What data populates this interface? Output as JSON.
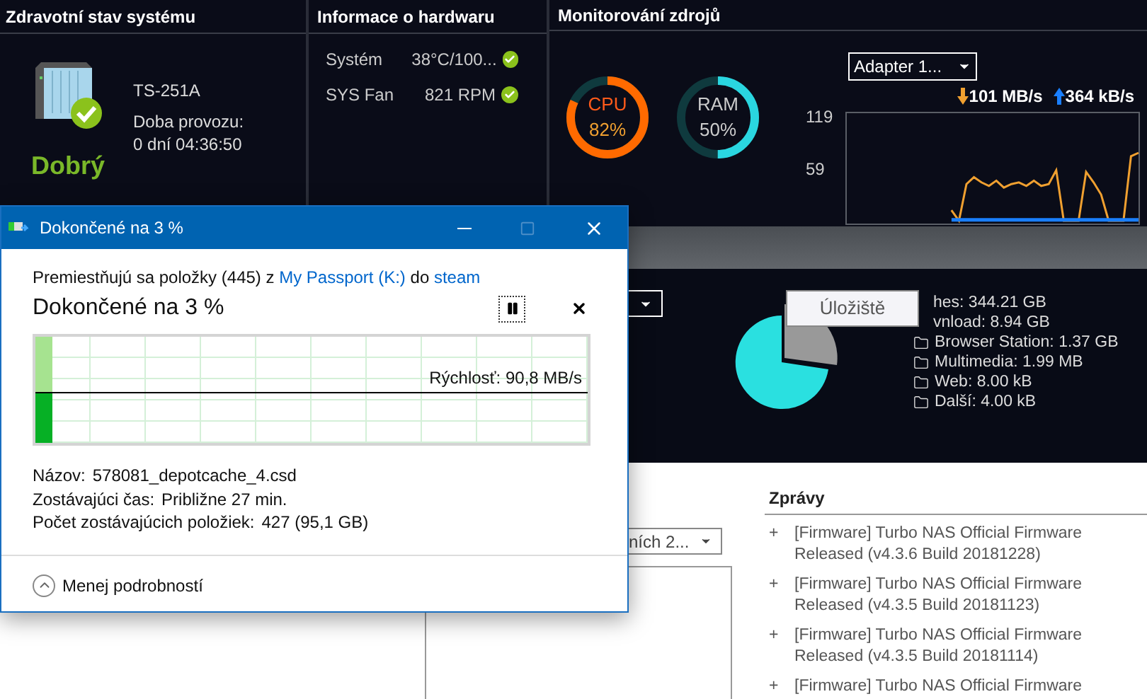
{
  "system_health": {
    "title": "Zdravotní stav systému",
    "model": "TS-251A",
    "uptime_label": "Doba provozu:",
    "uptime": "0 dní 04:36:50",
    "status": "Dobrý",
    "healthy": true
  },
  "hardware": {
    "title": "Informace o hardwaru",
    "rows": [
      {
        "name": "Systém",
        "value": "38°C/100...",
        "ok": true
      },
      {
        "name": "SYS Fan",
        "value": "821 RPM",
        "ok": true
      }
    ]
  },
  "resources": {
    "title": "Monitorování zdrojů",
    "meters": [
      {
        "name": "CPU",
        "reading": "82%",
        "level": 0.82,
        "color": "#ff6a00"
      },
      {
        "name": "RAM",
        "reading": "50%",
        "level": 0.5,
        "color": "#2ad6e0"
      }
    ],
    "adapter": {
      "value": "Adapter 1..."
    },
    "download": "101 MB/s",
    "upload": "364 kB/s",
    "graph_labels": [
      "119",
      "59"
    ]
  },
  "storage": {
    "tooltip": "Úložiště",
    "folders": [
      {
        "kind": "partial",
        "text": "hes: 344.21 GB"
      },
      {
        "kind": "partial",
        "text": "vnload: 8.94 GB"
      },
      {
        "kind": "folder",
        "text": "Browser Station: 1.37 GB"
      },
      {
        "kind": "folder",
        "text": "Multimedia: 1.99 MB"
      },
      {
        "kind": "folder",
        "text": "Web: 8.00 kB"
      },
      {
        "kind": "folder",
        "text": "Další: 4.00 kB"
      }
    ]
  },
  "lower": {
    "range_dropdown": {
      "value": "ních 2..."
    },
    "news": {
      "title": "Zprávy",
      "items": [
        {
          "marker": "+",
          "text": "[Firmware] Turbo NAS Official Firmware Released (v4.3.6 Build 20181228)"
        },
        {
          "marker": "+",
          "text": "[Firmware] Turbo NAS Official Firmware Released (v4.3.5 Build 20181123)"
        },
        {
          "marker": "+",
          "text": "[Firmware] Turbo NAS Official Firmware Released (v4.3.5 Build 20181114)"
        },
        {
          "marker": "+",
          "text": "[Firmware] Turbo NAS Official Firmware"
        }
      ]
    }
  },
  "dialog": {
    "title": "Dokončené na 3 %",
    "maximize_disabled": true,
    "description": [
      {
        "kind": "text",
        "text": "Premiestňujú sa položky (445) z "
      },
      {
        "kind": "link",
        "text": "My Passport (K:)"
      },
      {
        "kind": "text",
        "text": " do "
      },
      {
        "kind": "link",
        "text": "steam"
      }
    ],
    "heading": "Dokončené na 3 %",
    "progress": {
      "level": 0.03
    },
    "speed": "Rýchlosť: 90,8 MB/s",
    "details": [
      {
        "label": "Názov:",
        "value": "578081_depotcache_4.csd"
      },
      {
        "label": "Zostávajúci čas:",
        "value": "Približne 27 min."
      },
      {
        "label": "Počet zostávajúcich položiek:",
        "value": "427 (95,1 GB)"
      }
    ],
    "toggle": "Menej podrobností"
  }
}
